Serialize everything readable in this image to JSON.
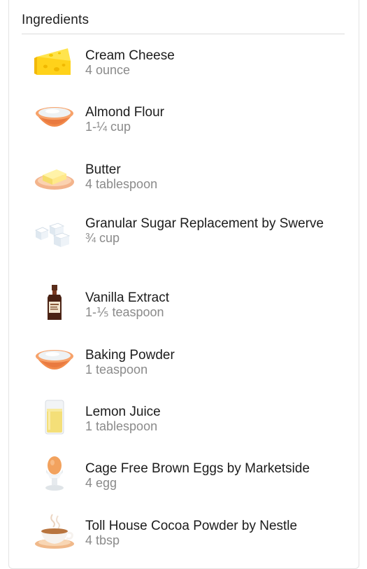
{
  "section": {
    "title": "Ingredients"
  },
  "ingredients": [
    {
      "name": "Cream Cheese",
      "quantity": "4 ounce",
      "icon": "cheese-icon"
    },
    {
      "name": "Almond Flour",
      "quantity": "1-¼ cup",
      "icon": "flour-bowl-icon"
    },
    {
      "name": "Butter",
      "quantity": "4 tablespoon",
      "icon": "butter-icon"
    },
    {
      "name": "Granular Sugar Replacement by Swerve",
      "quantity": "¾ cup",
      "icon": "sugar-cubes-icon"
    },
    {
      "name": "Vanilla Extract",
      "quantity": "1-⅕ teaspoon",
      "icon": "vanilla-bottle-icon"
    },
    {
      "name": "Baking Powder",
      "quantity": "1 teaspoon",
      "icon": "powder-bowl-icon"
    },
    {
      "name": "Lemon Juice",
      "quantity": "1 tablespoon",
      "icon": "juice-glass-icon"
    },
    {
      "name": "Cage Free Brown Eggs by Marketside",
      "quantity": "4 egg",
      "icon": "egg-cup-icon"
    },
    {
      "name": "Toll House Cocoa Powder by Nestle",
      "quantity": "4 tbsp",
      "icon": "coffee-cup-icon"
    }
  ]
}
